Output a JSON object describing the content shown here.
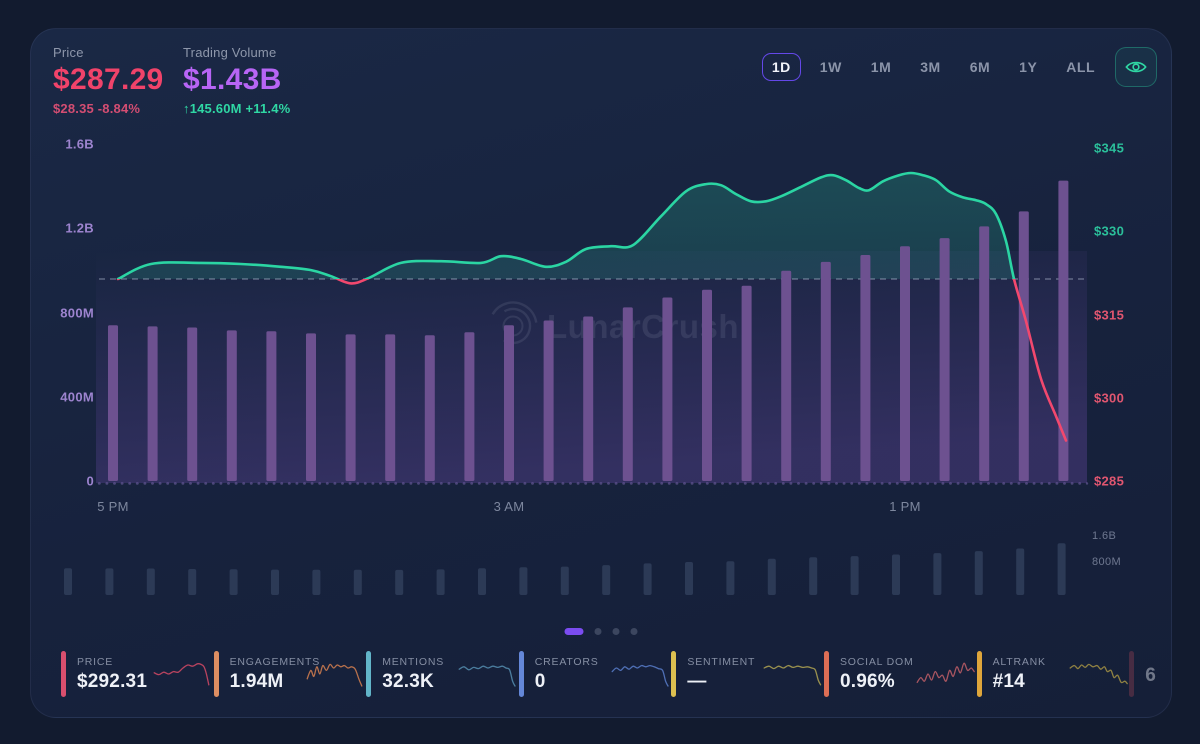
{
  "header": {
    "price": {
      "label": "Price",
      "value": "$287.29",
      "change": "$28.35  -8.84%"
    },
    "volume": {
      "label": "Trading Volume",
      "value": "$1.43B",
      "change": "↑145.60M  +11.4%"
    },
    "timeframes": [
      "1D",
      "1W",
      "1M",
      "3M",
      "6M",
      "1Y",
      "ALL"
    ],
    "active_timeframe": "1D"
  },
  "watermark": "LunarCrush",
  "chart_data": [
    {
      "type": "bar",
      "name": "trading-volume-bars",
      "interval": "hourly, 5 PM to 5 PM (1D view)",
      "values_millions": [
        739,
        734,
        729,
        715,
        711,
        701,
        696,
        696,
        692,
        706,
        739,
        762,
        781,
        824,
        871,
        908,
        927,
        998,
        1040,
        1073,
        1115,
        1153,
        1209,
        1280,
        1426
      ],
      "y_axis_left": {
        "labels": [
          "1.6B",
          "1.2B",
          "800M",
          "400M",
          "0"
        ],
        "range_millions": [
          0,
          1600
        ]
      },
      "x_ticks": [
        {
          "label": "5 PM",
          "index": 0
        },
        {
          "label": "3 AM",
          "index": 10
        },
        {
          "label": "1 PM",
          "index": 20
        }
      ],
      "bar_color": "#6d5190"
    },
    {
      "type": "line",
      "name": "price-line",
      "reference_price": 321.4,
      "y_axis_right": {
        "labels": [
          "$345",
          "$330",
          "$315",
          "$300",
          "$285"
        ],
        "range": [
          285,
          345
        ]
      },
      "color_above_reference": "#2bd5a3",
      "color_below_reference": "#f2486e",
      "points": [
        [
          87,
          321.4
        ],
        [
          120,
          324.1
        ],
        [
          170,
          324.3
        ],
        [
          210,
          324.1
        ],
        [
          250,
          323.6
        ],
        [
          280,
          323.0
        ],
        [
          300,
          321.9
        ],
        [
          320,
          320.6
        ],
        [
          338,
          321.6
        ],
        [
          370,
          324.3
        ],
        [
          410,
          324.6
        ],
        [
          450,
          324.3
        ],
        [
          470,
          325.5
        ],
        [
          490,
          325.0
        ],
        [
          515,
          323.6
        ],
        [
          535,
          324.5
        ],
        [
          555,
          326.8
        ],
        [
          580,
          327.3
        ],
        [
          602,
          327.5
        ],
        [
          630,
          332.7
        ],
        [
          655,
          337.2
        ],
        [
          675,
          338.5
        ],
        [
          690,
          338.3
        ],
        [
          705,
          336.7
        ],
        [
          720,
          335.4
        ],
        [
          735,
          335.4
        ],
        [
          750,
          336.3
        ],
        [
          770,
          338.0
        ],
        [
          790,
          339.7
        ],
        [
          802,
          340.1
        ],
        [
          815,
          339.2
        ],
        [
          828,
          337.8
        ],
        [
          838,
          337.4
        ],
        [
          852,
          339.0
        ],
        [
          868,
          340.1
        ],
        [
          880,
          340.5
        ],
        [
          892,
          340.1
        ],
        [
          905,
          339.2
        ],
        [
          918,
          337.2
        ],
        [
          932,
          336.1
        ],
        [
          945,
          335.6
        ],
        [
          955,
          334.9
        ],
        [
          965,
          333.1
        ],
        [
          975,
          328.2
        ],
        [
          983,
          321.4
        ],
        [
          995,
          313.8
        ],
        [
          1010,
          303.4
        ],
        [
          1025,
          296.7
        ],
        [
          1035,
          292.3
        ]
      ]
    },
    {
      "type": "bar",
      "name": "navigator-mini-bars",
      "values_millions": [
        739,
        734,
        729,
        715,
        711,
        701,
        696,
        696,
        692,
        706,
        739,
        762,
        781,
        824,
        871,
        908,
        927,
        998,
        1040,
        1073,
        1115,
        1153,
        1209,
        1280,
        1426
      ],
      "y_labels": [
        "1.6B",
        "800M"
      ],
      "bar_color": "#2e3c58"
    }
  ],
  "pagination": {
    "count": 4,
    "active_index": 0
  },
  "metric_cards": [
    {
      "label": "PRICE",
      "value": "$292.31",
      "accent": "#d94f6e",
      "spark_color": "#b8435f",
      "spark": [
        [
          2,
          20
        ],
        [
          10,
          23
        ],
        [
          18,
          19
        ],
        [
          26,
          22
        ],
        [
          34,
          18
        ],
        [
          42,
          19
        ],
        [
          50,
          12
        ],
        [
          58,
          7
        ],
        [
          66,
          9
        ],
        [
          74,
          5
        ],
        [
          80,
          6
        ],
        [
          85,
          10
        ],
        [
          89,
          22
        ],
        [
          93,
          40
        ]
      ]
    },
    {
      "label": "ENGAGEMENTS",
      "value": "1.94M",
      "accent": "#dd8e62",
      "spark_color": "#b8714c",
      "spark": [
        [
          2,
          30
        ],
        [
          8,
          16
        ],
        [
          13,
          26
        ],
        [
          18,
          10
        ],
        [
          23,
          22
        ],
        [
          28,
          8
        ],
        [
          34,
          16
        ],
        [
          40,
          6
        ],
        [
          46,
          12
        ],
        [
          52,
          7
        ],
        [
          58,
          10
        ],
        [
          64,
          8
        ],
        [
          70,
          12
        ],
        [
          76,
          10
        ],
        [
          82,
          14
        ],
        [
          88,
          30
        ],
        [
          93,
          42
        ]
      ]
    },
    {
      "label": "MENTIONS",
      "value": "32.3K",
      "accent": "#62b5c9",
      "spark_color": "#4b7d9e",
      "spark": [
        [
          2,
          14
        ],
        [
          10,
          10
        ],
        [
          18,
          15
        ],
        [
          26,
          11
        ],
        [
          34,
          13
        ],
        [
          42,
          9
        ],
        [
          50,
          12
        ],
        [
          58,
          9
        ],
        [
          66,
          11
        ],
        [
          74,
          9
        ],
        [
          80,
          12
        ],
        [
          86,
          15
        ],
        [
          91,
          34
        ],
        [
          95,
          42
        ]
      ]
    },
    {
      "label": "CREATORS",
      "value": "0",
      "accent": "#6487d8",
      "spark_color": "#4f6fb5",
      "spark": [
        [
          2,
          18
        ],
        [
          9,
          12
        ],
        [
          16,
          16
        ],
        [
          23,
          10
        ],
        [
          30,
          14
        ],
        [
          37,
          9
        ],
        [
          44,
          12
        ],
        [
          51,
          8
        ],
        [
          58,
          10
        ],
        [
          65,
          8
        ],
        [
          72,
          10
        ],
        [
          79,
          13
        ],
        [
          86,
          16
        ],
        [
          91,
          34
        ],
        [
          95,
          42
        ]
      ]
    },
    {
      "label": "SENTIMENT",
      "value": "—",
      "accent": "#ddc050",
      "spark_color": "#99904e",
      "spark": [
        [
          2,
          12
        ],
        [
          10,
          9
        ],
        [
          18,
          13
        ],
        [
          26,
          9
        ],
        [
          34,
          12
        ],
        [
          42,
          8
        ],
        [
          50,
          11
        ],
        [
          58,
          9
        ],
        [
          66,
          11
        ],
        [
          74,
          10
        ],
        [
          81,
          12
        ],
        [
          87,
          15
        ],
        [
          92,
          32
        ],
        [
          96,
          40
        ]
      ]
    },
    {
      "label": "SOCIAL DOM",
      "value": "0.96%",
      "accent": "#dd6e55",
      "spark_color": "#a85560",
      "spark": [
        [
          2,
          36
        ],
        [
          8,
          28
        ],
        [
          14,
          34
        ],
        [
          20,
          22
        ],
        [
          26,
          32
        ],
        [
          32,
          18
        ],
        [
          38,
          28
        ],
        [
          44,
          24
        ],
        [
          50,
          34
        ],
        [
          56,
          16
        ],
        [
          62,
          26
        ],
        [
          68,
          10
        ],
        [
          74,
          20
        ],
        [
          80,
          4
        ],
        [
          86,
          16
        ],
        [
          92,
          12
        ],
        [
          97,
          18
        ]
      ]
    },
    {
      "label": "ALTRANK",
      "value": "#14",
      "accent": "#dfa63b",
      "spark_color": "#8f8142",
      "spark": [
        [
          2,
          12
        ],
        [
          9,
          8
        ],
        [
          15,
          13
        ],
        [
          21,
          7
        ],
        [
          27,
          11
        ],
        [
          33,
          6
        ],
        [
          40,
          10
        ],
        [
          47,
          8
        ],
        [
          53,
          14
        ],
        [
          59,
          10
        ],
        [
          64,
          18
        ],
        [
          70,
          16
        ],
        [
          75,
          28
        ],
        [
          81,
          24
        ],
        [
          87,
          36
        ],
        [
          93,
          34
        ],
        [
          97,
          38
        ]
      ]
    },
    {
      "label": "",
      "value": "6",
      "accent": "#8c3e52",
      "spark_color": "#6b4455",
      "dim": true,
      "spark": [
        [
          2,
          12
        ],
        [
          30,
          16
        ],
        [
          60,
          10
        ],
        [
          97,
          18
        ]
      ]
    }
  ]
}
